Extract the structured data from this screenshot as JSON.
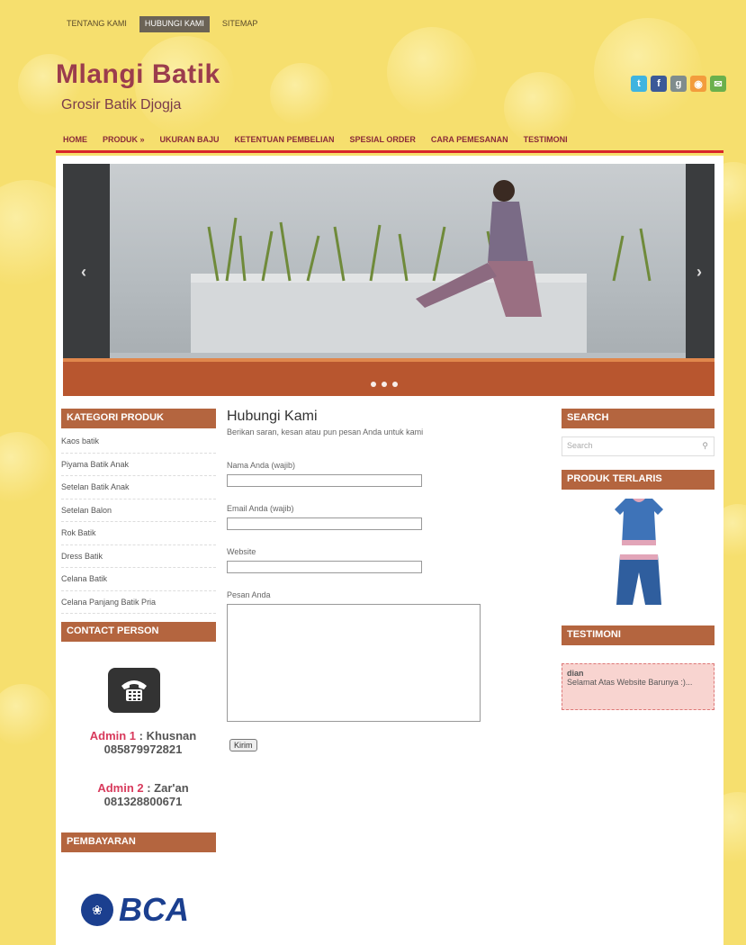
{
  "top_nav": [
    "TENTANG KAMI",
    "HUBUNGI KAMI",
    "SITEMAP"
  ],
  "site": {
    "title": "Mlangi Batik",
    "tagline": "Grosir Batik Djogja"
  },
  "social_icons": [
    "twitter-icon",
    "facebook-icon",
    "google-plus-icon",
    "rss-icon",
    "email-icon"
  ],
  "main_nav": [
    "HOME",
    "PRODUK »",
    "UKURAN BAJU",
    "KETENTUAN PEMBELIAN",
    "SPESIAL ORDER",
    "CARA PEMESANAN",
    "TESTIMONI"
  ],
  "slider": {
    "prev": "‹",
    "next": "›",
    "slides": 3
  },
  "sidebar_left": {
    "categories_title": "KATEGORI PRODUK",
    "categories": [
      "Kaos batik",
      "Piyama Batik Anak",
      "Setelan Batik Anak",
      "Setelan Balon",
      "Rok Batik",
      "Dress Batik",
      "Celana Batik",
      "Celana Panjang Batik Pria"
    ],
    "contact_title": "CONTACT PERSON",
    "admins": [
      {
        "label": "Admin 1",
        "name": "Khusnan",
        "phone": "085879972821"
      },
      {
        "label": "Admin 2",
        "name": "Zar'an",
        "phone": "081328800671"
      }
    ],
    "payment_title": "PEMBAYARAN",
    "bank_name": "BCA"
  },
  "contact_form": {
    "title": "Hubungi Kami",
    "description": "Berikan saran, kesan atau pun pesan Anda untuk kami",
    "fields": {
      "name_label": "Nama Anda (wajib)",
      "email_label": "Email Anda (wajib)",
      "website_label": "Website",
      "message_label": "Pesan Anda"
    },
    "submit": "Kirim"
  },
  "sidebar_right": {
    "search_title": "SEARCH",
    "search_placeholder": "Search",
    "bestseller_title": "PRODUK TERLARIS",
    "testimoni_title": "TESTIMONI",
    "testimoni": {
      "author": "dian",
      "text": "Selamat Atas Website Barunya :)..."
    }
  },
  "colors": {
    "background": "#f6df6e",
    "accent": "#b4653f",
    "title": "#9b3c4d",
    "nav_underline": "#d8262a"
  }
}
